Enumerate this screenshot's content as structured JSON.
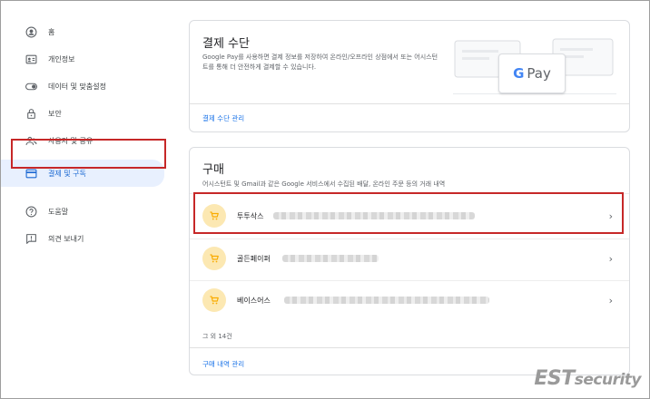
{
  "sidebar": {
    "items": [
      {
        "label": "홈",
        "icon": "account-circle-icon"
      },
      {
        "label": "개인정보",
        "icon": "id-card-icon"
      },
      {
        "label": "데이터 및 맞춤설정",
        "icon": "toggle-icon"
      },
      {
        "label": "보안",
        "icon": "lock-icon"
      },
      {
        "label": "사용자 및 공유",
        "icon": "people-icon"
      },
      {
        "label": "결제 및 구독",
        "icon": "credit-card-icon",
        "active": true
      },
      {
        "label": "도움말",
        "icon": "help-icon"
      },
      {
        "label": "의견 보내기",
        "icon": "feedback-icon"
      }
    ]
  },
  "payment": {
    "title": "결제 수단",
    "description": "Google Pay를 사용하면 결제 정보를 저장하여 온라인/오프라인 상점에서 또는 어시스턴트를 통해 더 안전하게 결제할 수 있습니다.",
    "gpay_g": "G",
    "gpay_pay": "Pay",
    "link": "결제 수단 관리"
  },
  "purchases": {
    "title": "구매",
    "description": "어시스턴트 및 Gmail과 같은 Google 서비스에서 수집된 배달, 온라인 주문 등의 거래 내역",
    "items": [
      {
        "label": "투투삭스"
      },
      {
        "label": "골든페이퍼"
      },
      {
        "label": "베이스어스"
      }
    ],
    "more": "그 외 14건",
    "link": "구매 내역 관리"
  },
  "watermark": {
    "est": "EST",
    "security": "security"
  },
  "colors": {
    "accent": "#1a73e8",
    "highlight": "#c62828",
    "active_bg": "#e8f0fe",
    "cart_bg": "#fce8b2",
    "cart_icon": "#f9ab00"
  }
}
